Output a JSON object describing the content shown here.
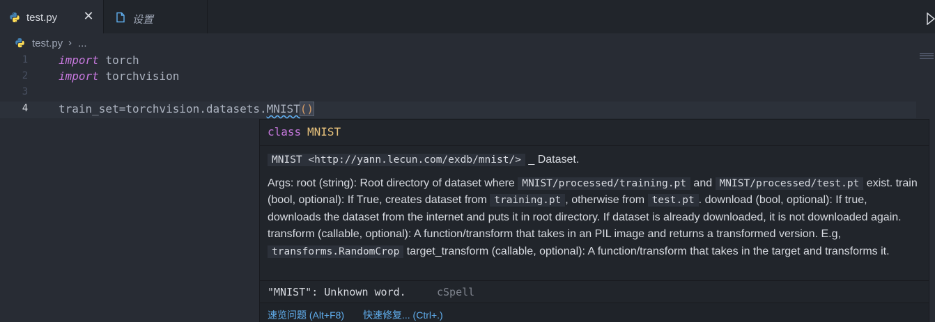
{
  "tabs": [
    {
      "label": "test.py",
      "icon": "python-file-icon",
      "active": true
    },
    {
      "label": "设置",
      "icon": "settings-file-icon",
      "active": false
    }
  ],
  "tab_close_glyph": "✕",
  "breadcrumb": {
    "file": "test.py",
    "separator": "›",
    "more": "..."
  },
  "editor": {
    "line_numbers": [
      "1",
      "2",
      "3",
      "4"
    ],
    "lines": {
      "l1": {
        "kw": "import",
        "rest": " torch"
      },
      "l2": {
        "kw": "import",
        "rest": " torchvision"
      },
      "l4": {
        "pre": "train_set=torchvision.datasets.",
        "ident": "MNIST",
        "paren": "()"
      }
    }
  },
  "hover": {
    "signature": {
      "keyword": "class",
      "name": "MNIST"
    },
    "p1": {
      "code": "MNIST <http://yann.lecun.com/exdb/mnist/>",
      "text": " _ Dataset."
    },
    "p2": {
      "t1": "Args: root (string): Root directory of dataset where ",
      "c1": "MNIST/processed/training.pt",
      "t2": " and ",
      "c2": "MNIST/processed/test.pt",
      "t3": " exist. train (bool, optional): If True, creates dataset from ",
      "c3": "training.pt",
      "t4": ", otherwise from ",
      "c4": "test.pt",
      "t5": ". download (bool, optional): If true, downloads the dataset from the internet and puts it in root directory. If dataset is already downloaded, it is not downloaded again. transform (callable, optional): A function/transform that takes in an PIL image and returns a transformed version. E.g, ",
      "c5": "transforms.RandomCrop",
      "t6": " target_transform (callable, optional): A function/transform that takes in the target and transforms it."
    },
    "diagnostic": {
      "message": "\"MNIST\": Unknown word.",
      "source": "cSpell"
    },
    "actions": {
      "peek": "速览问题 (Alt+F8)",
      "quickfix": "快速修复... (Ctrl+.)"
    }
  },
  "colors": {
    "background": "#282c34",
    "keyword": "#c678dd",
    "class_name": "#e5c07b",
    "link": "#61afef"
  }
}
